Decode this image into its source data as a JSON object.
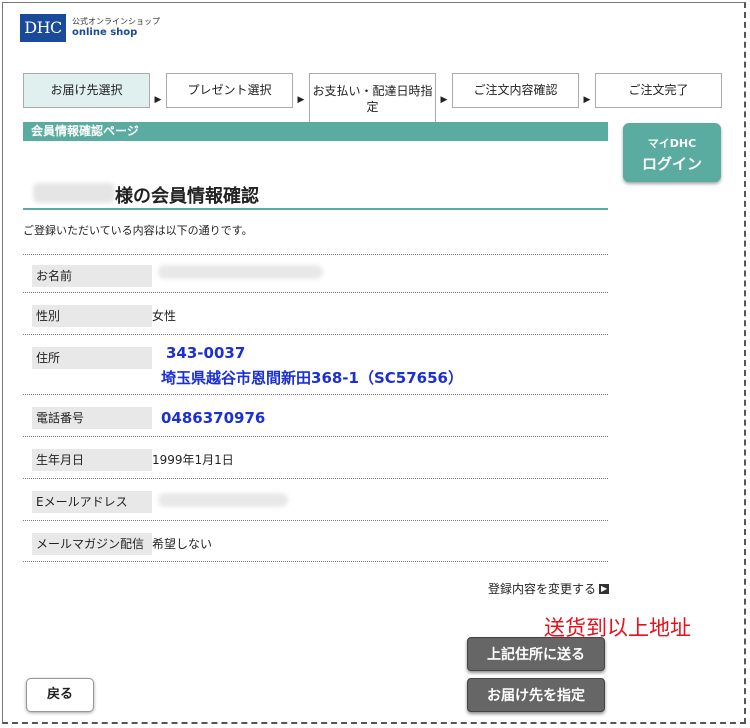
{
  "logo": {
    "mark": "DHC",
    "subtitle": "公式オンラインショップ",
    "title": "online shop"
  },
  "steps": [
    {
      "label": "お届け先選択"
    },
    {
      "label": "プレゼント選択"
    },
    {
      "label": "お支払い・配達日時指定"
    },
    {
      "label": "ご注文内容確認"
    },
    {
      "label": "ご注文完了"
    }
  ],
  "section_title": "会員情報確認ページ",
  "mydhc": {
    "top": "マイDHC",
    "main": "ログイン"
  },
  "heading": "様の会員情報確認",
  "intro": "ご登録いただいている内容は以下の通りです。",
  "rows": {
    "name": {
      "label": "お名前"
    },
    "gender": {
      "label": "性別",
      "value": "女性"
    },
    "address": {
      "label": "住所",
      "zip": "343-0037",
      "line": "埼玉県越谷市恩間新田368-1（SC57656）"
    },
    "phone": {
      "label": "電話番号",
      "value": "0486370976"
    },
    "birthday": {
      "label": "生年月日",
      "value": "1999年1月1日"
    },
    "email": {
      "label": "Eメールアドレス"
    },
    "magazine": {
      "label": "メールマガジン配信",
      "value": "希望しない"
    }
  },
  "change_link": "登録内容を変更する",
  "annotation": "送货到以上地址",
  "buttons": {
    "send_above": "上記住所に送る",
    "specify_delivery": "お届け先を指定",
    "back": "戻る"
  },
  "colors": {
    "accent": "#5aaba0",
    "value_blue": "#1a2fd4",
    "annotation_red": "#e8101a",
    "logo_blue": "#1a4a9a"
  }
}
